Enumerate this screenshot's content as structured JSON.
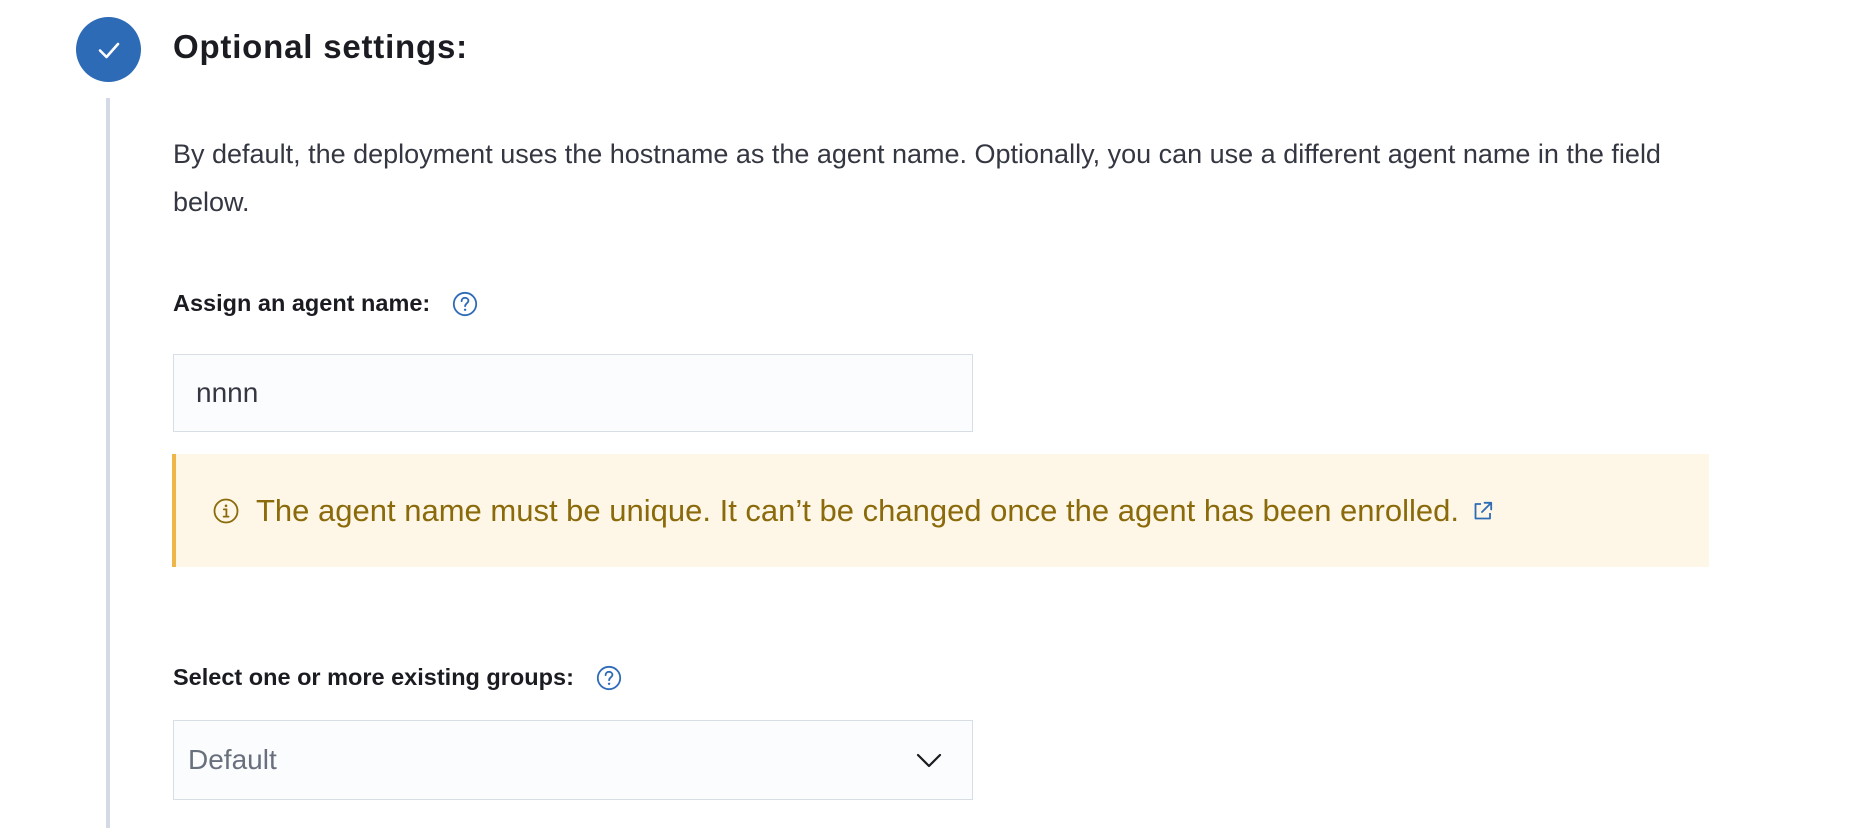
{
  "step": {
    "title": "Optional settings:",
    "status": "complete",
    "accent_color": "#2e6bb7"
  },
  "description": "By default, the deployment uses the hostname as the agent name. Optionally, you can use a different agent name in the field below.",
  "agent_name": {
    "label": "Assign an agent name:",
    "help_icon": "question-circle-icon",
    "value": "nnnn"
  },
  "callout": {
    "icon": "info-circle-icon",
    "text": "The agent name must be unique. It can’t be changed once the agent has been enrolled.",
    "link_icon": "external-link-icon",
    "bg_color": "#fef6e6",
    "border_color": "#f0b548",
    "text_color": "#8a6a0a"
  },
  "groups": {
    "label": "Select one or more existing groups:",
    "help_icon": "question-circle-icon",
    "selected": "Default",
    "dropdown_icon": "chevron-down-icon"
  }
}
